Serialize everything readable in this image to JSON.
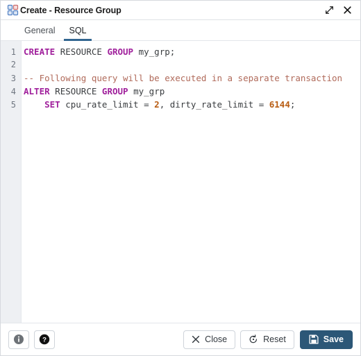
{
  "window": {
    "title": "Create - Resource Group",
    "title_icon": "resource-group-grid-icon",
    "expand_label": "Maximize",
    "close_label": "Close",
    "accent_color": "#326690",
    "save_color": "#2c5777"
  },
  "tabs": [
    {
      "label": "General",
      "active": false
    },
    {
      "label": "SQL",
      "active": true
    }
  ],
  "editor": {
    "language": "sql",
    "line_numbers": [
      "1",
      "2",
      "3",
      "4",
      "5"
    ],
    "lines": [
      {
        "number": "1",
        "text": "CREATE RESOURCE GROUP my_grp;",
        "tokens": [
          {
            "t": "CREATE",
            "k": "kw"
          },
          {
            "t": " ",
            "k": "pun"
          },
          {
            "t": "RESOURCE",
            "k": "id"
          },
          {
            "t": " ",
            "k": "pun"
          },
          {
            "t": "GROUP",
            "k": "kw"
          },
          {
            "t": " ",
            "k": "pun"
          },
          {
            "t": "my_grp",
            "k": "id"
          },
          {
            "t": ";",
            "k": "pun"
          }
        ]
      },
      {
        "number": "2",
        "text": "",
        "tokens": []
      },
      {
        "number": "3",
        "text": "-- Following query will be executed in a separate transaction",
        "tokens": [
          {
            "t": "-- Following query will be executed in a separate transaction",
            "k": "com"
          }
        ]
      },
      {
        "number": "4",
        "text": "ALTER RESOURCE GROUP my_grp",
        "tokens": [
          {
            "t": "ALTER",
            "k": "kw"
          },
          {
            "t": " ",
            "k": "pun"
          },
          {
            "t": "RESOURCE",
            "k": "id"
          },
          {
            "t": " ",
            "k": "pun"
          },
          {
            "t": "GROUP",
            "k": "kw"
          },
          {
            "t": " ",
            "k": "pun"
          },
          {
            "t": "my_grp",
            "k": "id"
          }
        ]
      },
      {
        "number": "5",
        "text": "    SET cpu_rate_limit = 2, dirty_rate_limit = 6144;",
        "tokens": [
          {
            "t": "    ",
            "k": "pun"
          },
          {
            "t": "SET",
            "k": "kw"
          },
          {
            "t": " ",
            "k": "pun"
          },
          {
            "t": "cpu_rate_limit",
            "k": "id"
          },
          {
            "t": " = ",
            "k": "pun"
          },
          {
            "t": "2",
            "k": "num"
          },
          {
            "t": ", ",
            "k": "pun"
          },
          {
            "t": "dirty_rate_limit",
            "k": "id"
          },
          {
            "t": " = ",
            "k": "pun"
          },
          {
            "t": "6144",
            "k": "num"
          },
          {
            "t": ";",
            "k": "pun"
          }
        ]
      }
    ]
  },
  "footer": {
    "info_label": "i",
    "help_label": "?",
    "close_label": "Close",
    "reset_label": "Reset",
    "save_label": "Save"
  }
}
